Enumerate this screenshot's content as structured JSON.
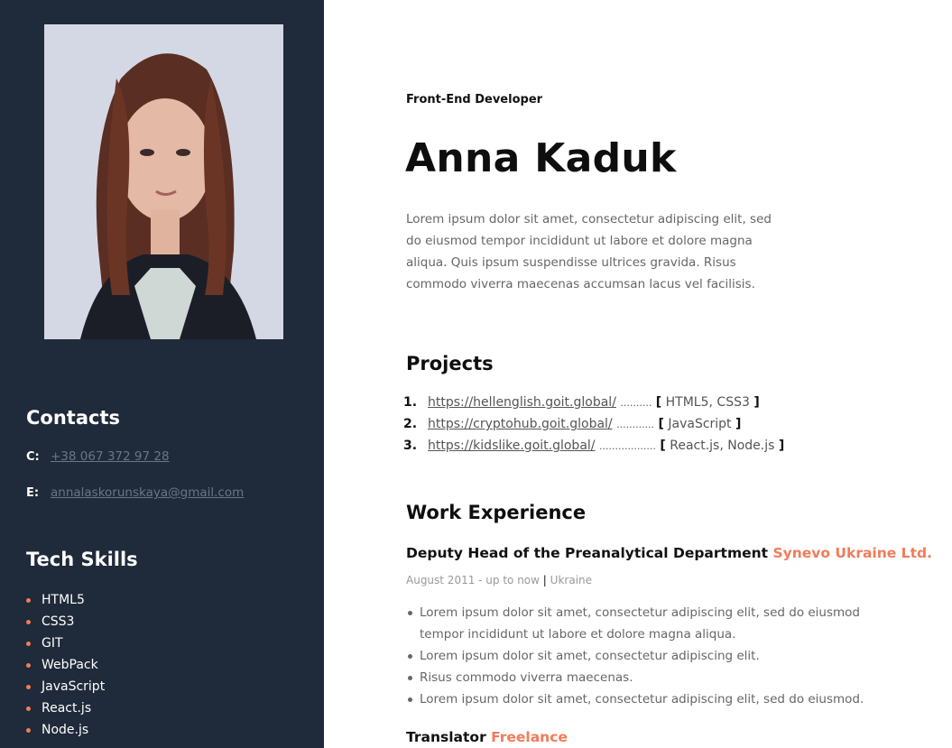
{
  "colors": {
    "sidebar_bg": "#1f2a3a",
    "accent": "#f07c5a"
  },
  "contacts": {
    "title": "Contacts",
    "phone_key": "C:",
    "phone": "+38 067 372 97 28",
    "email_key": "E:",
    "email": "annalaskorunskaya@gmail.com"
  },
  "skills": {
    "title": "Tech Skills",
    "items": [
      "HTML5",
      "CSS3",
      "GIT",
      "WebPack",
      "JavaScript",
      "React.js",
      "Node.js"
    ]
  },
  "profile": {
    "role": "Front-End Developer",
    "name": "Anna Kaduk",
    "about": "Lorem ipsum dolor sit amet, consectetur adipiscing elit, sed do eiusmod tempor incididunt ut labore et dolore magna aliqua. Quis ipsum suspendisse ultrices gravida. Risus commodo viverra maecenas accumsan lacus vel facilisis."
  },
  "projects": {
    "title": "Projects",
    "items": [
      {
        "num": "1.",
        "url": "https://hellenglish.goit.global/",
        "dots": "..........",
        "open": "[",
        "tech": " HTML5, CSS3 ",
        "close": "]"
      },
      {
        "num": "2.",
        "url": "https://cryptohub.goit.global/",
        "dots": "............",
        "open": "[",
        "tech": " JavaScript ",
        "close": "]"
      },
      {
        "num": "3.",
        "url": "https://kidslike.goit.global/",
        "dots": "..................",
        "open": "[",
        "tech": " React.js, Node.js ",
        "close": "]"
      }
    ]
  },
  "experience": {
    "title": "Work Experience",
    "jobs": [
      {
        "position": "Deputy Head of the Preanalytical Department",
        "company": "Synevo Ukraine Ltd.",
        "period": "August 2011 - up to now",
        "separator": "|",
        "location": "Ukraine",
        "bullets": [
          "Lorem ipsum dolor sit amet, consectetur adipiscing elit, sed do eiusmod tempor incididunt ut labore et dolore magna aliqua.",
          "Lorem ipsum dolor sit amet, consectetur adipiscing elit.",
          "Risus commodo viverra maecenas.",
          "Lorem ipsum dolor sit amet, consectetur adipiscing elit, sed do eiusmod."
        ]
      },
      {
        "position": "Translator",
        "company": "Freelance"
      }
    ]
  }
}
